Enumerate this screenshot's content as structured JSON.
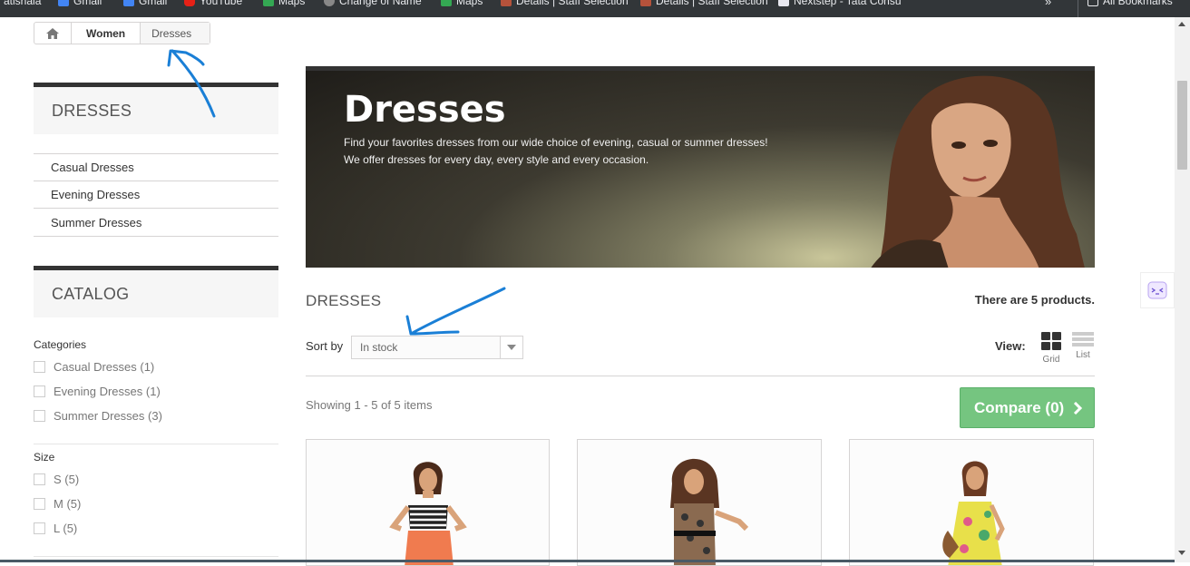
{
  "bookmarks": [
    "atishala",
    "Gmail",
    "Gmail",
    "YouTube",
    "Maps",
    "Change of Name",
    "Maps",
    "Details | Staff Selection",
    "Details | Staff Selection",
    "Nextstep - Tata Consu",
    "All Bookmarks"
  ],
  "breadcrumb": {
    "items": [
      "Women",
      "Dresses"
    ]
  },
  "sidebar": {
    "dresses_title": "DRESSES",
    "subcategories": [
      "Casual Dresses",
      "Evening Dresses",
      "Summer Dresses"
    ],
    "catalog_title": "CATALOG",
    "categories_label": "Categories",
    "categories": [
      "Casual Dresses (1)",
      "Evening Dresses (1)",
      "Summer Dresses (3)"
    ],
    "size_label": "Size",
    "sizes": [
      "S (5)",
      "M (5)",
      "L (5)"
    ]
  },
  "banner": {
    "title": "Dresses",
    "line1": "Find your favorites dresses from our wide choice of evening, casual or summer dresses!",
    "line2": "We offer dresses for every day, every style and every occasion."
  },
  "listing": {
    "heading": "DRESSES",
    "count_text": "There are 5 products.",
    "sort_label": "Sort by",
    "sort_value": "In stock",
    "view_label": "View:",
    "view_grid": "Grid",
    "view_list": "List",
    "showing": "Showing 1 - 5 of 5 items",
    "compare": "Compare (0)"
  },
  "colors": {
    "compare_green": "#75c580",
    "annotation_blue": "#1a7fd6",
    "dark_bar": "#333333"
  },
  "icons": [
    "home-icon",
    "chevron-right-icon",
    "grid-view-icon",
    "list-view-icon",
    "checkbox-icon",
    "chat-icon"
  ]
}
